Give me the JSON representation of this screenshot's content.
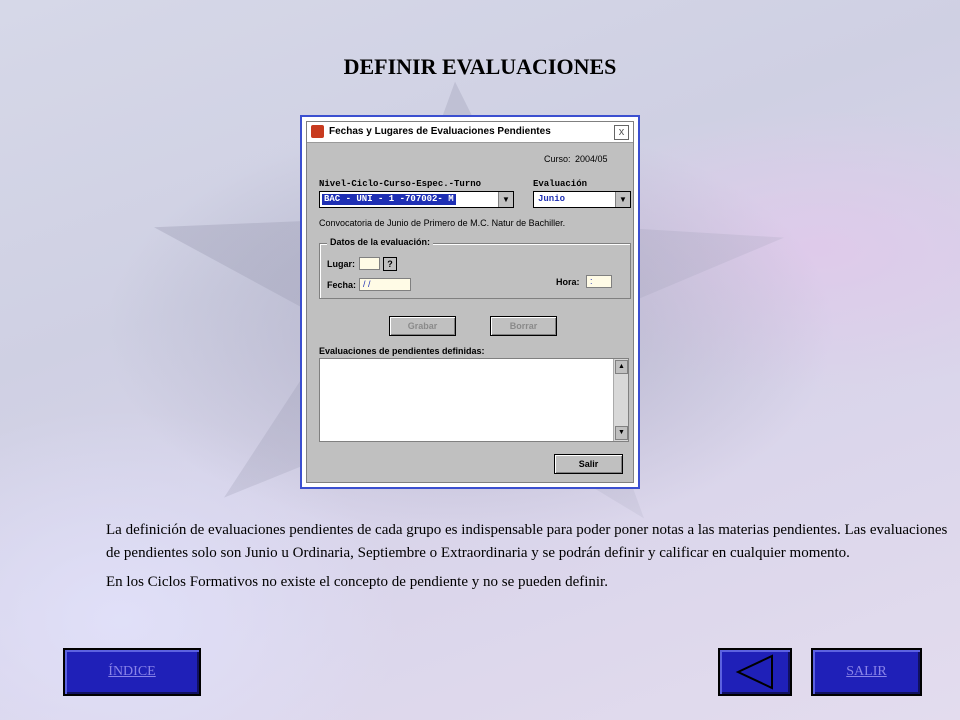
{
  "page": {
    "title": "DEFINIR EVALUACIONES"
  },
  "dialog": {
    "title": "Fechas y Lugares de Evaluaciones Pendientes",
    "close_label": "x",
    "curso_label": "Curso:",
    "curso_value": "2004/05",
    "nivel_label": "Nivel-Ciclo-Curso-Espec.-Turno",
    "nivel_value": "BAC - UNI -  1  -707002-  M",
    "evaluacion_label": "Evaluación",
    "evaluacion_value": "Junio",
    "convocatoria_text": "Convocatoria de Junio de Primero de M.C. Natur de Bachiller.",
    "group_title": "Datos de la evaluación:",
    "lugar_label": "Lugar:",
    "lugar_help": "?",
    "fecha_label": "Fecha:",
    "fecha_value": " / /",
    "hora_label": "Hora:",
    "hora_value": " :",
    "grabar_label": "Grabar",
    "borrar_label": "Borrar",
    "list_label": "Evaluaciones de pendientes definidas:",
    "salir_label": "Salir"
  },
  "description": {
    "paragraph1": "La definición de evaluaciones pendientes de cada grupo es indispensable para poder poner notas a las materias pendientes.  Las evaluaciones de pendientes solo son Junio u Ordinaria, Septiembre o Extraordinaria y se podrán definir y calificar en cualquier momento.",
    "paragraph2": "En los Ciclos Formativos no existe el concepto de pendiente y no se pueden definir."
  },
  "navigation": {
    "index_label": "ÍNDICE",
    "exit_label": "SALIR"
  },
  "colors": {
    "nav_button": "#1f20b8",
    "link_text": "#8a84e8",
    "dialog_border": "#3b4fd0",
    "dialog_face": "#c0c0c0"
  }
}
